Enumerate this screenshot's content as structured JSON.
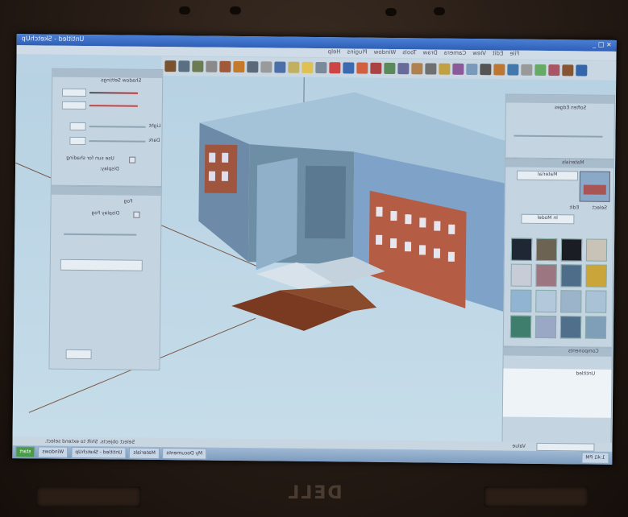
{
  "device": {
    "brand_logo": "DELL"
  },
  "window": {
    "title": "Untitled - SketchUp",
    "controls": "_ □ ×",
    "menus": [
      "File",
      "Edit",
      "View",
      "Camera",
      "Draw",
      "Tools",
      "Window",
      "Plugins",
      "Help"
    ]
  },
  "toolbar": {
    "tool_colors": [
      "#7a5230",
      "#5b6f83",
      "#6b7b52",
      "#8a8a8a",
      "#a05a3a",
      "#c47a2a",
      "#5a6a7a",
      "#9a9a9a",
      "#4b6fa8",
      "#c0b060",
      "#e0c050",
      "#7a8a9a",
      "#c44",
      "#3a6ab0",
      "#d06040",
      "#a44",
      "#5a8a5a",
      "#6a6a9a",
      "#b08050",
      "#707070",
      "#c0a040",
      "#8a5a9a",
      "#7a9abb",
      "#555",
      "#bb7733",
      "#4477aa",
      "#999",
      "#66aa66",
      "#aa5566",
      "#885533",
      "#3366aa"
    ]
  },
  "left_panel": {
    "title": "Shadow Settings",
    "fields": [
      "0:00 UTC",
      "10:58 AM",
      "Light",
      "Dark"
    ],
    "checkbox_label": "Use sun for shading",
    "display_label": "Display:"
  },
  "lower_left_panel": {
    "title": "Fog",
    "checkbox_label": "Display Fog"
  },
  "right_panel": {
    "soften_title": "Soften Edges",
    "materials_title": "Materials",
    "material_name": "Material",
    "tabs": [
      "Select",
      "Edit"
    ],
    "dropdown": "In Model",
    "swatches": [
      "#1f2734",
      "#6d6353",
      "#1a1e24",
      "#c9c2b6",
      "#c8ccd6",
      "#9c7680",
      "#4e6d88",
      "#c9a53a",
      "#90b4d2",
      "#b3c8da",
      "#9cb4c9",
      "#a9c2d5",
      "#3f7d6c",
      "#9aa8c6",
      "#4f6f8a",
      "#7f9fb8"
    ]
  },
  "components_panel": {
    "title": "Components",
    "list_item": "Untitled"
  },
  "statusbar": {
    "left_text": "Select objects. Shift to extend select.",
    "measurements_label": "Value"
  },
  "taskbar": {
    "start": "start",
    "tasks": [
      "Windows",
      "Untitled - SketchUp",
      "Materials",
      "My Documents"
    ],
    "clock": "1:41 PM"
  }
}
